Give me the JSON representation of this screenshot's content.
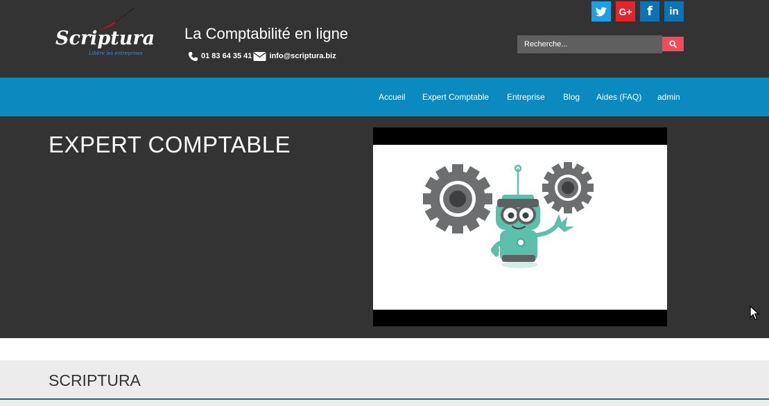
{
  "header": {
    "logo_text": "Scriptura",
    "logo_tagline": "Libère les entreprises",
    "site_title": "La Comptabilité en ligne",
    "phone": "01 83 64 35 41",
    "email": "info@scriptura.biz",
    "social": {
      "twitter": "twitter-icon",
      "google_plus": "G+",
      "facebook": "f",
      "linkedin": "in"
    },
    "search": {
      "placeholder": "Recherche..."
    }
  },
  "nav": {
    "items": [
      {
        "label": "Accueil"
      },
      {
        "label": "Expert Comptable"
      },
      {
        "label": "Entreprise"
      },
      {
        "label": "Blog"
      },
      {
        "label": "Aides (FAQ)"
      },
      {
        "label": "admin"
      }
    ]
  },
  "hero": {
    "title": "EXPERT COMPTABLE"
  },
  "section2": {
    "title": "SCRIPTURA"
  },
  "colors": {
    "header_bg": "#333333",
    "nav_bg": "#0a8abf",
    "twitter": "#1aa1e8",
    "google_plus": "#e0252d",
    "facebook": "#0d72b6",
    "search_button": "#f04a5b",
    "robot": "#5bbfa9",
    "gear": "#6d6e70"
  }
}
